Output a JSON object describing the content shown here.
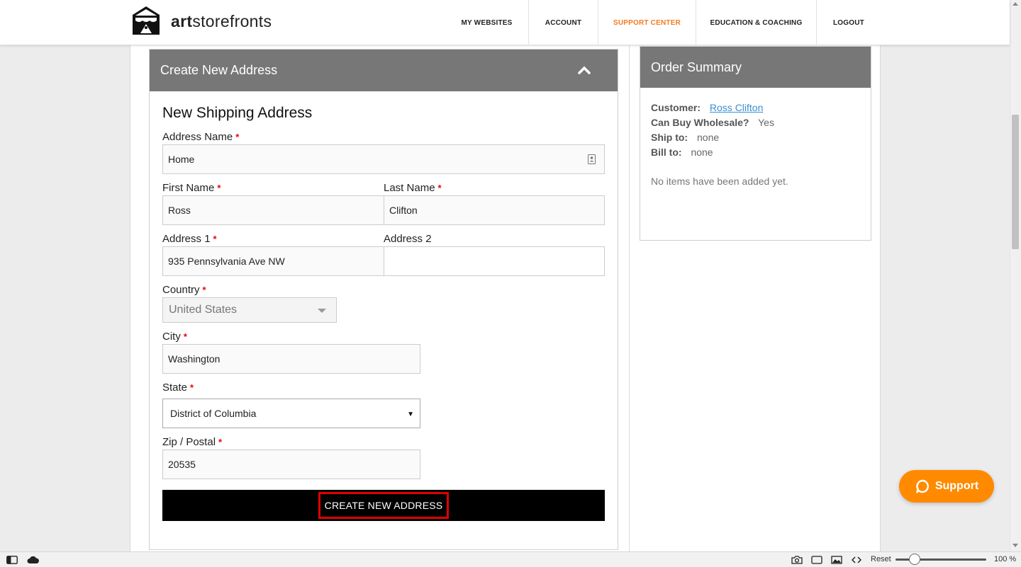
{
  "header": {
    "logo_text_bold": "art",
    "logo_text_rest": "storefronts",
    "nav": [
      {
        "label": "MY WEBSITES"
      },
      {
        "label": "ACCOUNT"
      },
      {
        "label": "SUPPORT CENTER"
      },
      {
        "label": "EDUCATION & COACHING"
      },
      {
        "label": "LOGOUT"
      }
    ]
  },
  "panel": {
    "title": "Create New Address",
    "form_title": "New Shipping Address",
    "required_mark": "*",
    "fields": {
      "address_name": {
        "label": "Address Name",
        "value": "Home"
      },
      "first_name": {
        "label": "First Name",
        "value": "Ross"
      },
      "last_name": {
        "label": "Last Name",
        "value": "Clifton"
      },
      "address1": {
        "label": "Address 1",
        "value": "935 Pennsylvania Ave NW"
      },
      "address2": {
        "label": "Address 2",
        "value": ""
      },
      "country": {
        "label": "Country",
        "value": "United States"
      },
      "city": {
        "label": "City",
        "value": "Washington"
      },
      "state": {
        "label": "State",
        "value": "District of Columbia"
      },
      "zip": {
        "label": "Zip / Postal",
        "value": "20535"
      }
    },
    "submit_label": "CREATE NEW ADDRESS"
  },
  "summary": {
    "title": "Order Summary",
    "customer_label": "Customer:",
    "customer_value": "Ross Clifton",
    "wholesale_label": "Can Buy Wholesale?",
    "wholesale_value": "Yes",
    "ship_label": "Ship to:",
    "ship_value": "none",
    "bill_label": "Bill to:",
    "bill_value": "none",
    "empty_text": "No items have been added yet."
  },
  "support": {
    "label": "Support"
  },
  "statusbar": {
    "reset_label": "Reset",
    "zoom_text": "100 %"
  },
  "colors": {
    "accent": "#f47b20",
    "panel_head": "#777777",
    "support": "#ff8a00",
    "highlight": "#e00000",
    "link": "#3b8fd0"
  }
}
